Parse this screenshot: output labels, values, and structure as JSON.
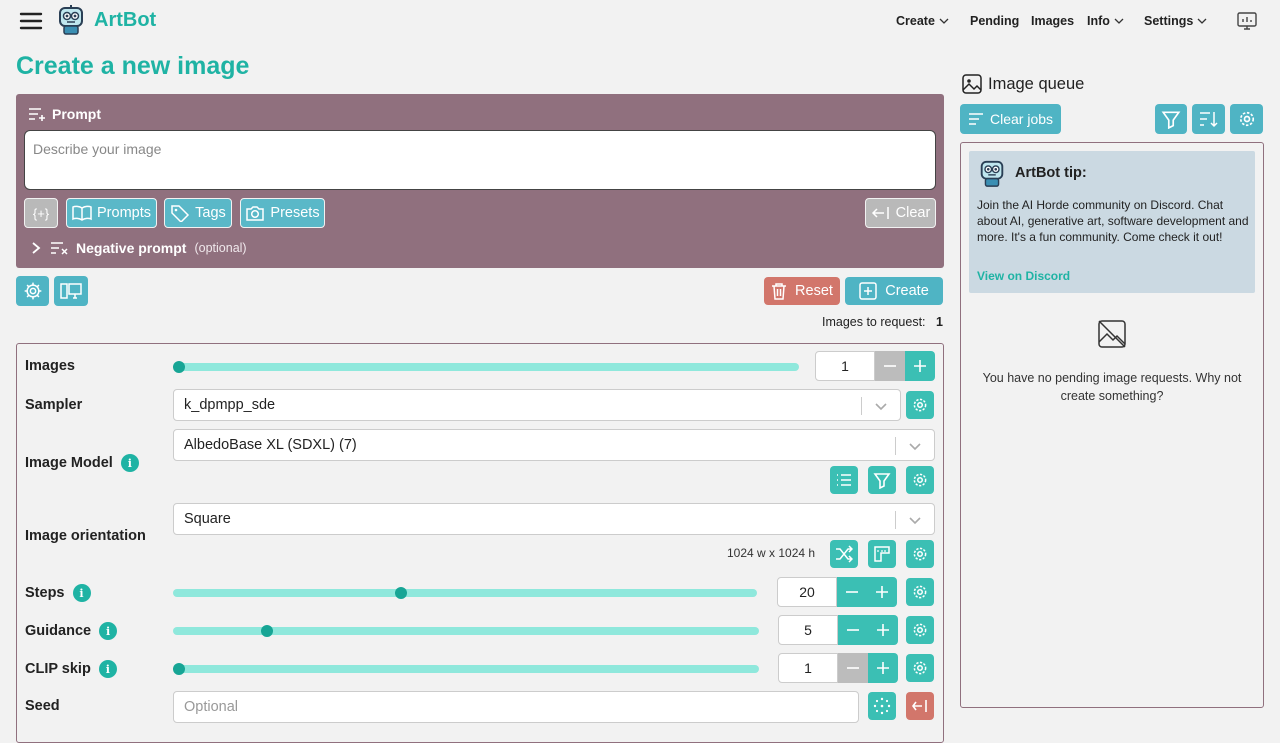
{
  "header": {
    "brand": "ArtBot",
    "nav": [
      {
        "label": "Create",
        "has_dropdown": true
      },
      {
        "label": "Pending",
        "has_dropdown": false
      },
      {
        "label": "Images",
        "has_dropdown": false
      },
      {
        "label": "Info",
        "has_dropdown": true
      },
      {
        "label": "Settings",
        "has_dropdown": true
      }
    ]
  },
  "page_title": "Create a new image",
  "prompt": {
    "heading": "Prompt",
    "placeholder": "Describe your image",
    "buttons": {
      "braces": "{+}",
      "prompts": "Prompts",
      "tags": "Tags",
      "presets": "Presets",
      "clear": "Clear"
    },
    "negative_label": "Negative prompt",
    "negative_optional": "(optional)"
  },
  "actions": {
    "reset": "Reset",
    "create": "Create"
  },
  "images_to_request": {
    "label": "Images to request:",
    "value": "1"
  },
  "options": {
    "images": {
      "label": "Images",
      "value": "1",
      "fraction": 0.0
    },
    "sampler": {
      "label": "Sampler",
      "value": "k_dpmpp_sde"
    },
    "model": {
      "label": "Image Model",
      "value": "AlbedoBase XL (SDXL) (7)"
    },
    "orientation": {
      "label": "Image orientation",
      "value": "Square",
      "dimensions": "1024 w x 1024 h"
    },
    "steps": {
      "label": "Steps",
      "value": "20",
      "fraction": 0.39
    },
    "guidance": {
      "label": "Guidance",
      "value": "5",
      "fraction": 0.16
    },
    "clip_skip": {
      "label": "CLIP skip",
      "value": "1",
      "fraction": 0.0
    },
    "seed": {
      "label": "Seed",
      "placeholder": "Optional"
    }
  },
  "queue": {
    "title": "Image queue",
    "clear_jobs": "Clear jobs",
    "tip_title": "ArtBot tip:",
    "tip_text": "Join the AI Horde community on Discord. Chat about AI, generative art, software development and more. It's a fun community. Come check it out!",
    "tip_link": "View on Discord",
    "empty_text": "You have no pending image requests. Why not create something?"
  },
  "colors": {
    "accent": "#1fb3a4",
    "button": "#3bbfb4",
    "prompt_panel": "#90707e",
    "reset": "#d2766b"
  }
}
